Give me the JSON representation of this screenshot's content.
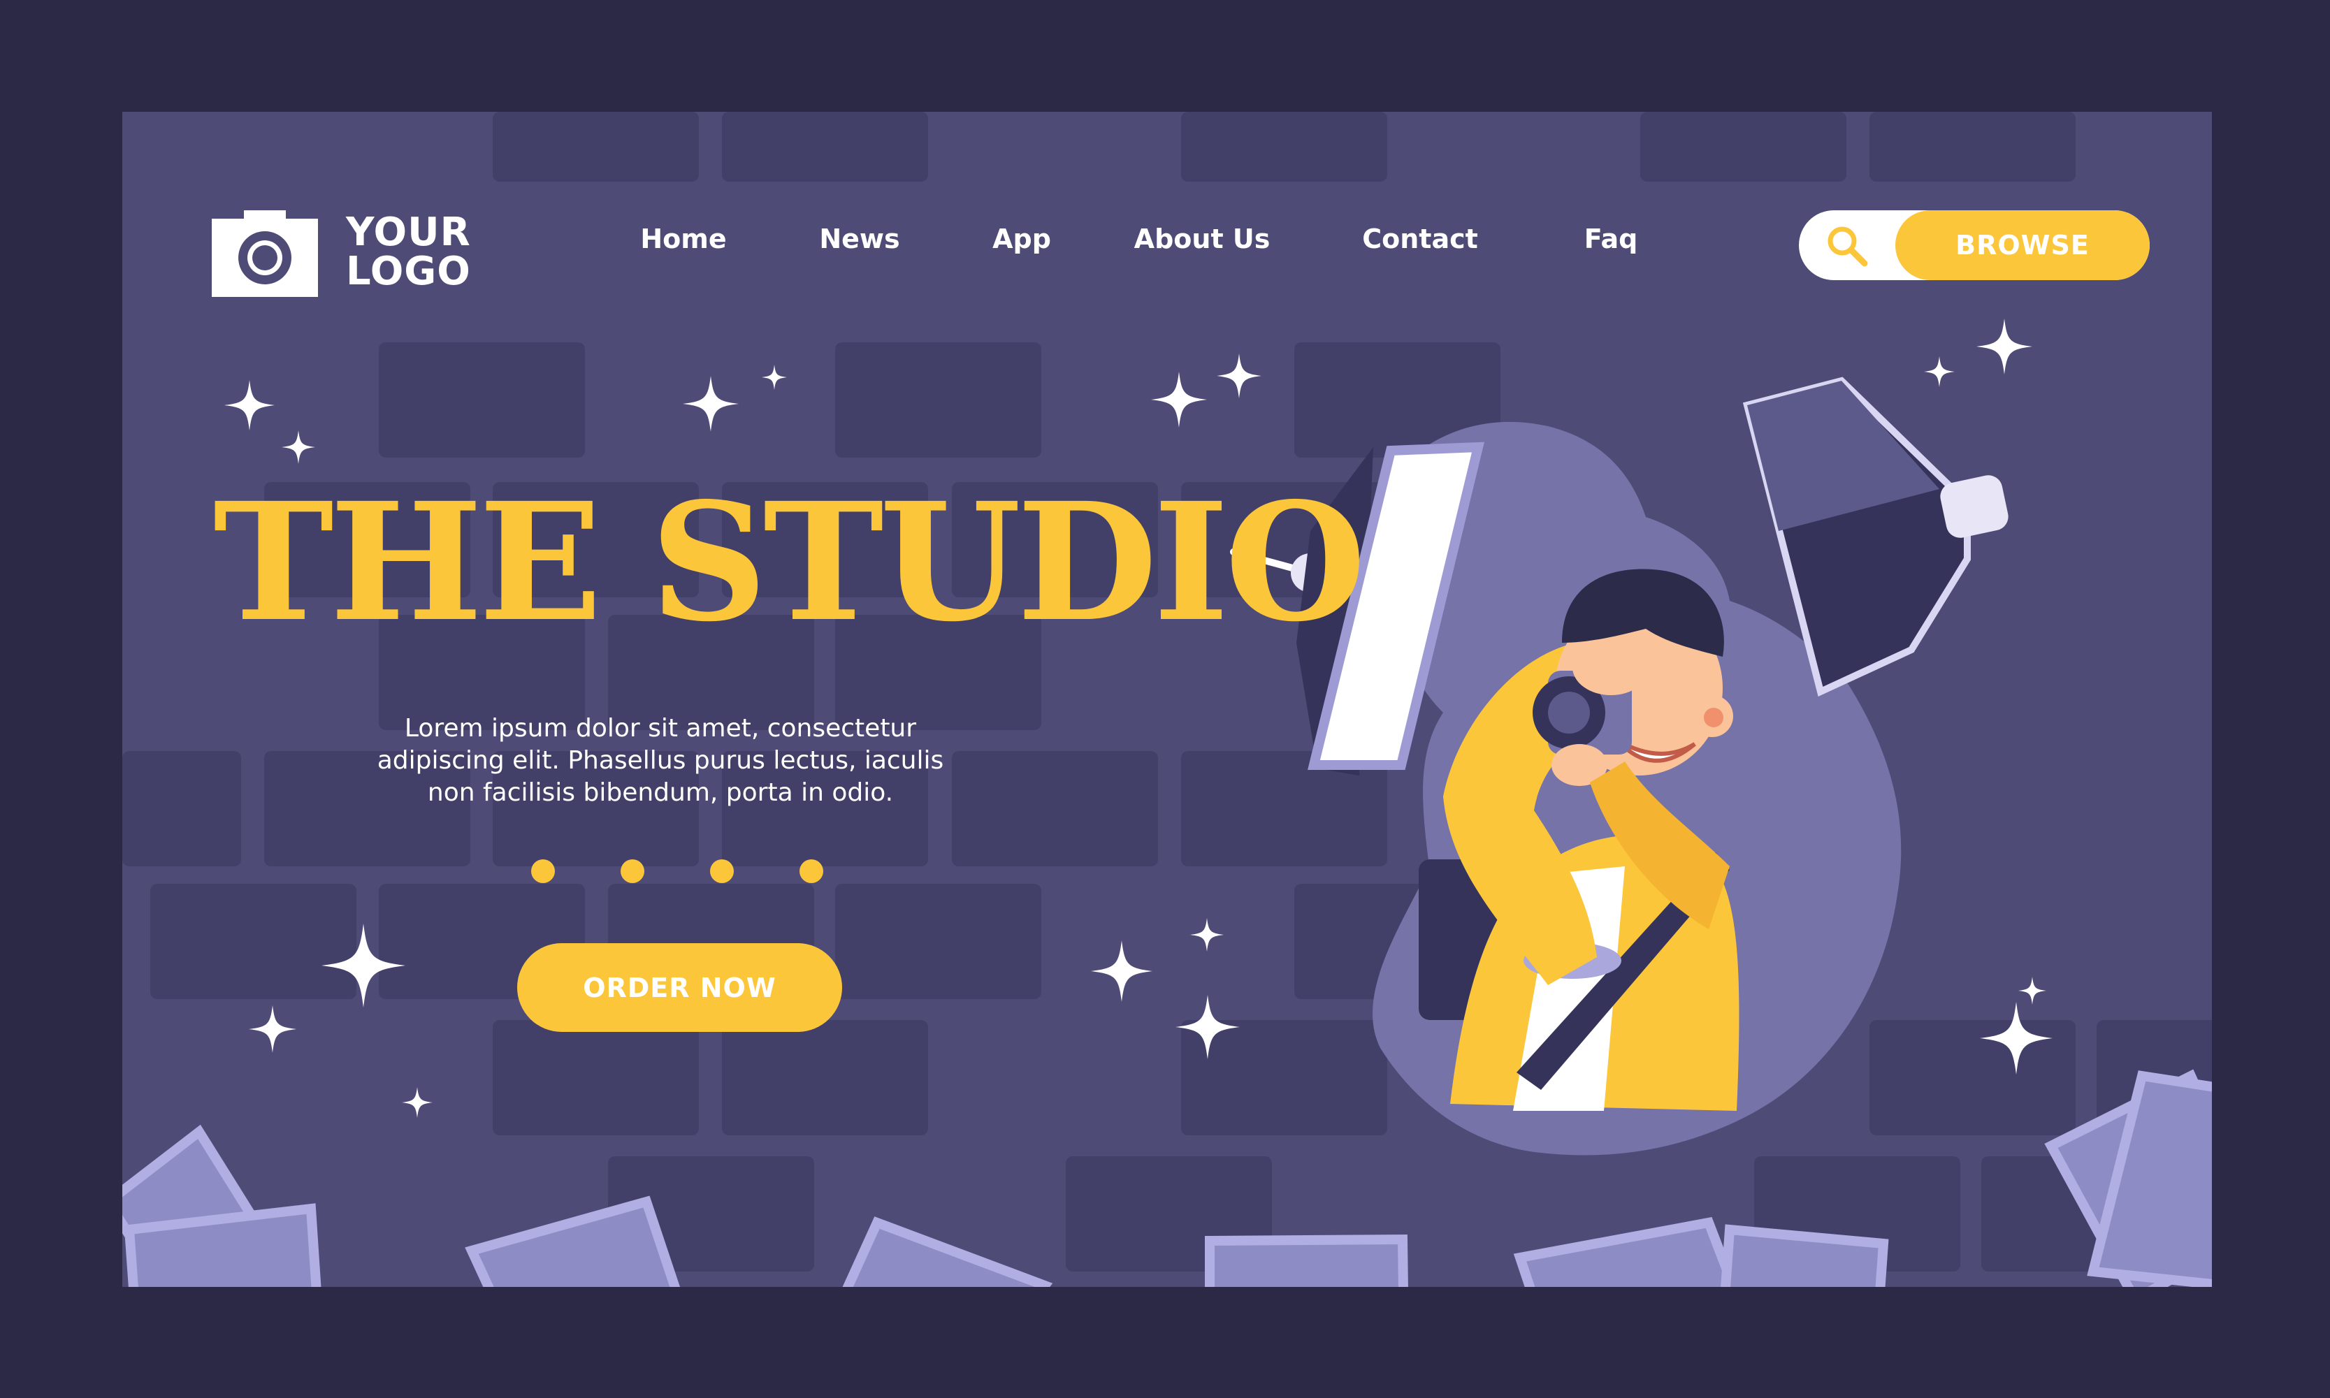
{
  "logo": {
    "line1": "YOUR",
    "line2": "LOGO",
    "icon": "camera-icon"
  },
  "nav": {
    "items": [
      {
        "label": "Home"
      },
      {
        "label": "News"
      },
      {
        "label": "App"
      },
      {
        "label": "About Us"
      },
      {
        "label": "Contact"
      },
      {
        "label": "Faq"
      }
    ]
  },
  "search": {
    "icon": "search-icon",
    "button_label": "BROWSE"
  },
  "hero": {
    "title": "THE STUDIO",
    "description": "Lorem ipsum dolor sit amet, consectetur adipiscing elit. Phasellus purus lectus, iaculis non facilisis bibendum, porta in odio.",
    "button_label": "ORDER NOW",
    "carousel_pages": 4
  },
  "colors": {
    "background": "#2c2946",
    "panel": "#4e4b76",
    "brick": "#424068",
    "accent": "#fcc63b",
    "text": "#ffffff"
  }
}
